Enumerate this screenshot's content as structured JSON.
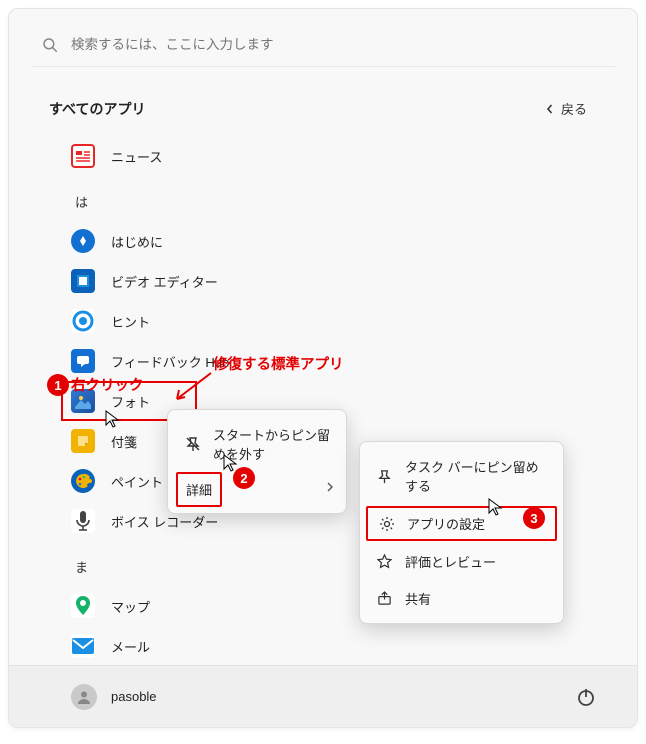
{
  "search": {
    "placeholder": "検索するには、ここに入力します"
  },
  "header": {
    "title": "すべてのアプリ",
    "back": "戻る"
  },
  "letters": {
    "ha": "は",
    "ma": "ま"
  },
  "apps": {
    "news": "ニュース",
    "hajimeni": "はじめに",
    "video": "ビデオ エディター",
    "hint": "ヒント",
    "feedback": "フィードバック Hub",
    "photo": "フォト",
    "fusen": "付箋",
    "paint": "ペイント",
    "voice": "ボイス レコーダー",
    "map": "マップ",
    "mail": "メール"
  },
  "ctx1": {
    "unpin": "スタートからピン留めを外す",
    "detail": "詳細"
  },
  "ctx2": {
    "taskbar": "タスク バーにピン留めする",
    "settings": "アプリの設定",
    "review": "評価とレビュー",
    "share": "共有"
  },
  "footer": {
    "user": "pasoble"
  },
  "anno": {
    "rightclick": "右クリック",
    "repair": "修復する標準アプリ",
    "b1": "1",
    "b2": "2",
    "b3": "3"
  }
}
